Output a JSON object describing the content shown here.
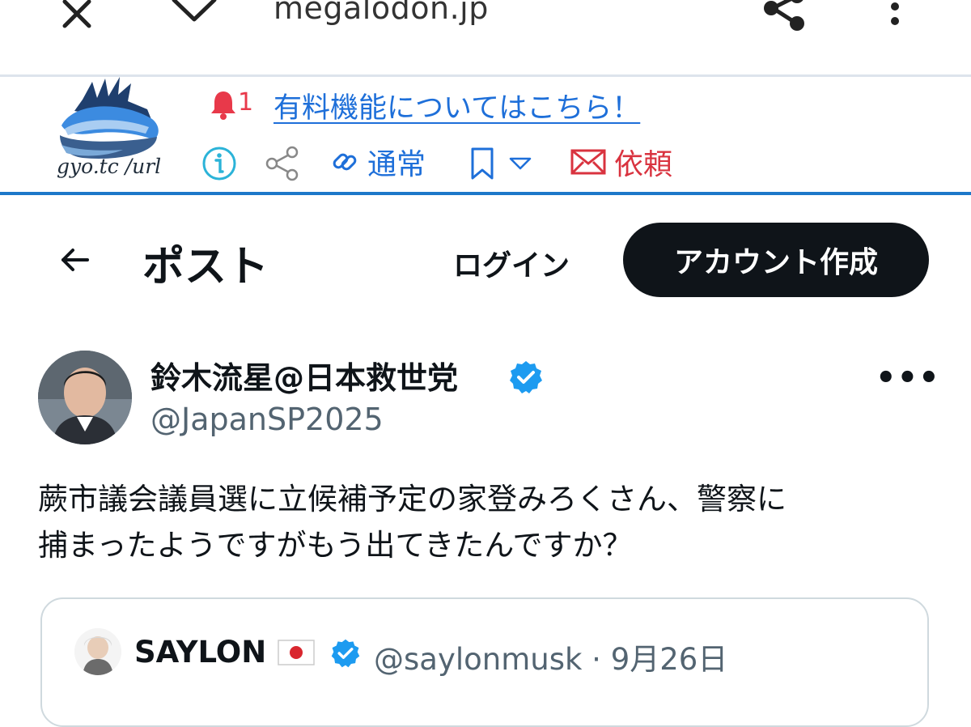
{
  "browser": {
    "url": "megalodon.jp",
    "icons": [
      "close-icon",
      "chevron-down-icon",
      "share-icon",
      "more-vertical-icon"
    ]
  },
  "gyo_toolbar": {
    "logo_text": "gyo.tc /url",
    "notification_count": "1",
    "paid_link": "有料機能についてはこちら！",
    "link_mode": "通常",
    "request": "依頼",
    "colors": {
      "link": "#1e6fd9",
      "alert": "#e8394a",
      "accent_line": "#1d78c9",
      "info": "#2bb3d8"
    }
  },
  "page_header": {
    "title": "ポスト",
    "login": "ログイン",
    "signup": "アカウント作成"
  },
  "post": {
    "author_name": "鈴木流星@日本救世党",
    "author_handle": "@JapanSP2025",
    "text": "蕨市議会議員選に立候補予定の家登みろくさん、警察に\n捕まったようですがもう出てきたんですか？",
    "verified_color": "#1d9bf0"
  },
  "quote": {
    "author_name": "SAYLON",
    "author_handle": "@saylonmusk",
    "separator": "·",
    "date": "9月26日",
    "handle_date": "@saylonmusk · 9月26日"
  }
}
